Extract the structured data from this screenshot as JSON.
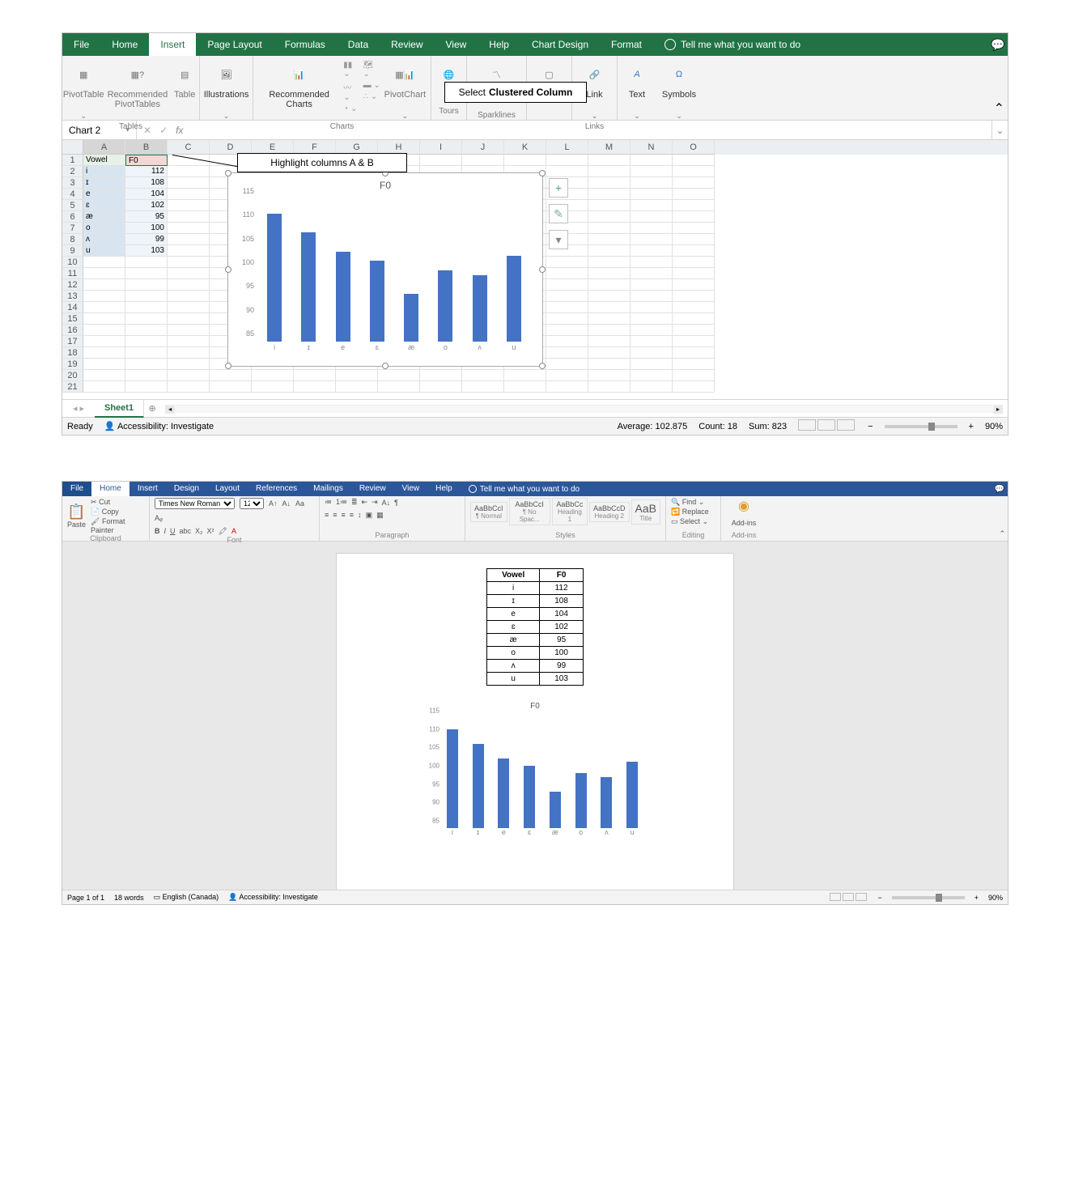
{
  "excel": {
    "tabs": [
      "File",
      "Home",
      "Insert",
      "Page Layout",
      "Formulas",
      "Data",
      "Review",
      "View",
      "Help",
      "Chart Design",
      "Format"
    ],
    "active_tab": "Insert",
    "tell_me": "Tell me what you want to do",
    "ribbon": {
      "tables": {
        "label": "Tables",
        "buttons": [
          "PivotTable",
          "Recommended PivotTables",
          "Table"
        ]
      },
      "illustrations": {
        "label": "",
        "button": "Illustrations"
      },
      "charts": {
        "label": "Charts",
        "recommended": "Recommended Charts",
        "pivotchart": "PivotChart"
      },
      "tours": {
        "label": "Tours"
      },
      "sparklines": {
        "label": "Sparklines",
        "line": "Line"
      },
      "links": {
        "label": "Links",
        "button": "Link"
      },
      "text": {
        "button": "Text"
      },
      "symbols": {
        "button": "Symbols"
      }
    },
    "callouts": {
      "clustered_select_prefix": "Select ",
      "clustered_select_bold": "Clustered Column",
      "highlight": "Highlight columns A & B"
    },
    "name_box": "Chart 2",
    "columns": [
      "A",
      "B",
      "C",
      "D",
      "E",
      "F",
      "G",
      "H",
      "I",
      "J",
      "K",
      "L",
      "M",
      "N",
      "O"
    ],
    "data_headers": {
      "A": "Vowel",
      "B": "F0"
    },
    "data_rows": [
      {
        "vowel": "i",
        "f0": 112
      },
      {
        "vowel": "ɪ",
        "f0": 108
      },
      {
        "vowel": "e",
        "f0": 104
      },
      {
        "vowel": "ɛ",
        "f0": 102
      },
      {
        "vowel": "æ",
        "f0": 95
      },
      {
        "vowel": "o",
        "f0": 100
      },
      {
        "vowel": "ʌ",
        "f0": 99
      },
      {
        "vowel": "u",
        "f0": 103
      }
    ],
    "chart": {
      "title": "F0",
      "y_ticks": [
        85,
        90,
        95,
        100,
        105,
        110,
        115
      ],
      "tool_plus": "+",
      "tool_brush": "✎",
      "tool_filter": "▾"
    },
    "sheet_tab": "Sheet1",
    "status": {
      "ready": "Ready",
      "accessibility": "Accessibility: Investigate",
      "average_label": "Average:",
      "average": "102.875",
      "count_label": "Count:",
      "count": "18",
      "sum_label": "Sum:",
      "sum": "823",
      "zoom": "90%"
    }
  },
  "word": {
    "tabs": [
      "File",
      "Home",
      "Insert",
      "Design",
      "Layout",
      "References",
      "Mailings",
      "Review",
      "View",
      "Help"
    ],
    "active_tab": "Home",
    "tell_me": "Tell me what you want to do",
    "clipboard": {
      "paste": "Paste",
      "cut": "Cut",
      "copy": "Copy",
      "fp": "Format Painter",
      "label": "Clipboard"
    },
    "font": {
      "name": "Times New Roman",
      "size": "12",
      "label": "Font"
    },
    "paragraph": {
      "label": "Paragraph"
    },
    "styles": {
      "label": "Styles",
      "tiles": [
        {
          "sample": "AaBbCcI",
          "name": "¶ Normal"
        },
        {
          "sample": "AaBbCcI",
          "name": "¶ No Spac..."
        },
        {
          "sample": "AaBbCc",
          "name": "Heading 1"
        },
        {
          "sample": "AaBbCcD",
          "name": "Heading 2"
        },
        {
          "sample": "AaB",
          "name": "Title"
        }
      ]
    },
    "editing": {
      "find": "Find",
      "replace": "Replace",
      "select": "Select",
      "label": "Editing"
    },
    "addins": {
      "button": "Add-ins",
      "label": "Add-ins"
    },
    "table_headers": {
      "vowel": "Vowel",
      "f0": "F0"
    },
    "status": {
      "page": "Page 1 of 1",
      "words": "18 words",
      "lang": "English (Canada)",
      "accessibility": "Accessibility: Investigate",
      "zoom": "90%"
    }
  },
  "chart_data": {
    "type": "bar",
    "title": "F0",
    "categories": [
      "i",
      "ɪ",
      "e",
      "ɛ",
      "æ",
      "o",
      "ʌ",
      "u"
    ],
    "values": [
      112,
      108,
      104,
      102,
      95,
      100,
      99,
      103
    ],
    "ylim": [
      85,
      115
    ],
    "xlabel": "",
    "ylabel": ""
  }
}
